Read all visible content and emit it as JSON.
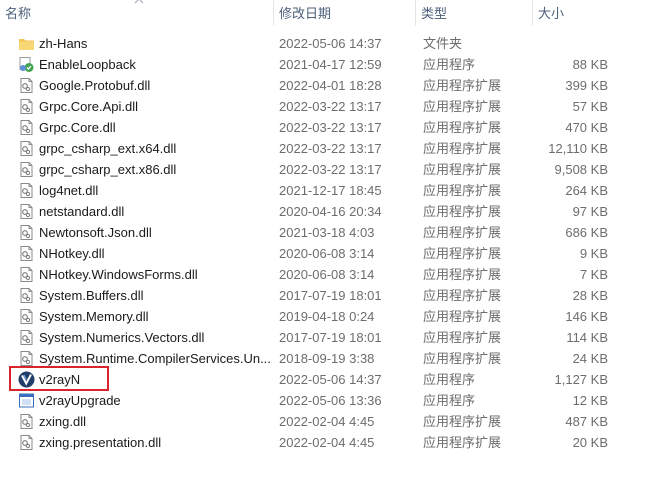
{
  "columns": {
    "name": "名称",
    "date": "修改日期",
    "type": "类型",
    "size": "大小"
  },
  "files": [
    {
      "name": "zh-Hans",
      "date": "2022-05-06 14:37",
      "type": "文件夹",
      "size": "",
      "icon": "folder-icon"
    },
    {
      "name": "EnableLoopback",
      "date": "2021-04-17 12:59",
      "type": "应用程序",
      "size": "88 KB",
      "icon": "app-icon"
    },
    {
      "name": "Google.Protobuf.dll",
      "date": "2022-04-01 18:28",
      "type": "应用程序扩展",
      "size": "399 KB",
      "icon": "dll-icon"
    },
    {
      "name": "Grpc.Core.Api.dll",
      "date": "2022-03-22 13:17",
      "type": "应用程序扩展",
      "size": "57 KB",
      "icon": "dll-icon"
    },
    {
      "name": "Grpc.Core.dll",
      "date": "2022-03-22 13:17",
      "type": "应用程序扩展",
      "size": "470 KB",
      "icon": "dll-icon"
    },
    {
      "name": "grpc_csharp_ext.x64.dll",
      "date": "2022-03-22 13:17",
      "type": "应用程序扩展",
      "size": "12,110 KB",
      "icon": "dll-icon"
    },
    {
      "name": "grpc_csharp_ext.x86.dll",
      "date": "2022-03-22 13:17",
      "type": "应用程序扩展",
      "size": "9,508 KB",
      "icon": "dll-icon"
    },
    {
      "name": "log4net.dll",
      "date": "2021-12-17 18:45",
      "type": "应用程序扩展",
      "size": "264 KB",
      "icon": "dll-icon"
    },
    {
      "name": "netstandard.dll",
      "date": "2020-04-16 20:34",
      "type": "应用程序扩展",
      "size": "97 KB",
      "icon": "dll-icon"
    },
    {
      "name": "Newtonsoft.Json.dll",
      "date": "2021-03-18 4:03",
      "type": "应用程序扩展",
      "size": "686 KB",
      "icon": "dll-icon"
    },
    {
      "name": "NHotkey.dll",
      "date": "2020-06-08 3:14",
      "type": "应用程序扩展",
      "size": "9 KB",
      "icon": "dll-icon"
    },
    {
      "name": "NHotkey.WindowsForms.dll",
      "date": "2020-06-08 3:14",
      "type": "应用程序扩展",
      "size": "7 KB",
      "icon": "dll-icon"
    },
    {
      "name": "System.Buffers.dll",
      "date": "2017-07-19 18:01",
      "type": "应用程序扩展",
      "size": "28 KB",
      "icon": "dll-icon"
    },
    {
      "name": "System.Memory.dll",
      "date": "2019-04-18 0:24",
      "type": "应用程序扩展",
      "size": "146 KB",
      "icon": "dll-icon"
    },
    {
      "name": "System.Numerics.Vectors.dll",
      "date": "2017-07-19 18:01",
      "type": "应用程序扩展",
      "size": "114 KB",
      "icon": "dll-icon"
    },
    {
      "name": "System.Runtime.CompilerServices.Un...",
      "date": "2018-09-19 3:38",
      "type": "应用程序扩展",
      "size": "24 KB",
      "icon": "dll-icon"
    },
    {
      "name": "v2rayN",
      "date": "2022-05-06 14:37",
      "type": "应用程序",
      "size": "1,127 KB",
      "icon": "v2rayn-app-icon"
    },
    {
      "name": "v2rayUpgrade",
      "date": "2022-05-06 13:36",
      "type": "应用程序",
      "size": "12 KB",
      "icon": "upgrade-app-icon"
    },
    {
      "name": "zxing.dll",
      "date": "2022-02-04 4:45",
      "type": "应用程序扩展",
      "size": "487 KB",
      "icon": "dll-icon"
    },
    {
      "name": "zxing.presentation.dll",
      "date": "2022-02-04 4:45",
      "type": "应用程序扩展",
      "size": "20 KB",
      "icon": "dll-icon"
    }
  ],
  "colors": {
    "highlight_border": "#d9242e",
    "header_text": "#4c607a",
    "folder": "#f3c655"
  }
}
